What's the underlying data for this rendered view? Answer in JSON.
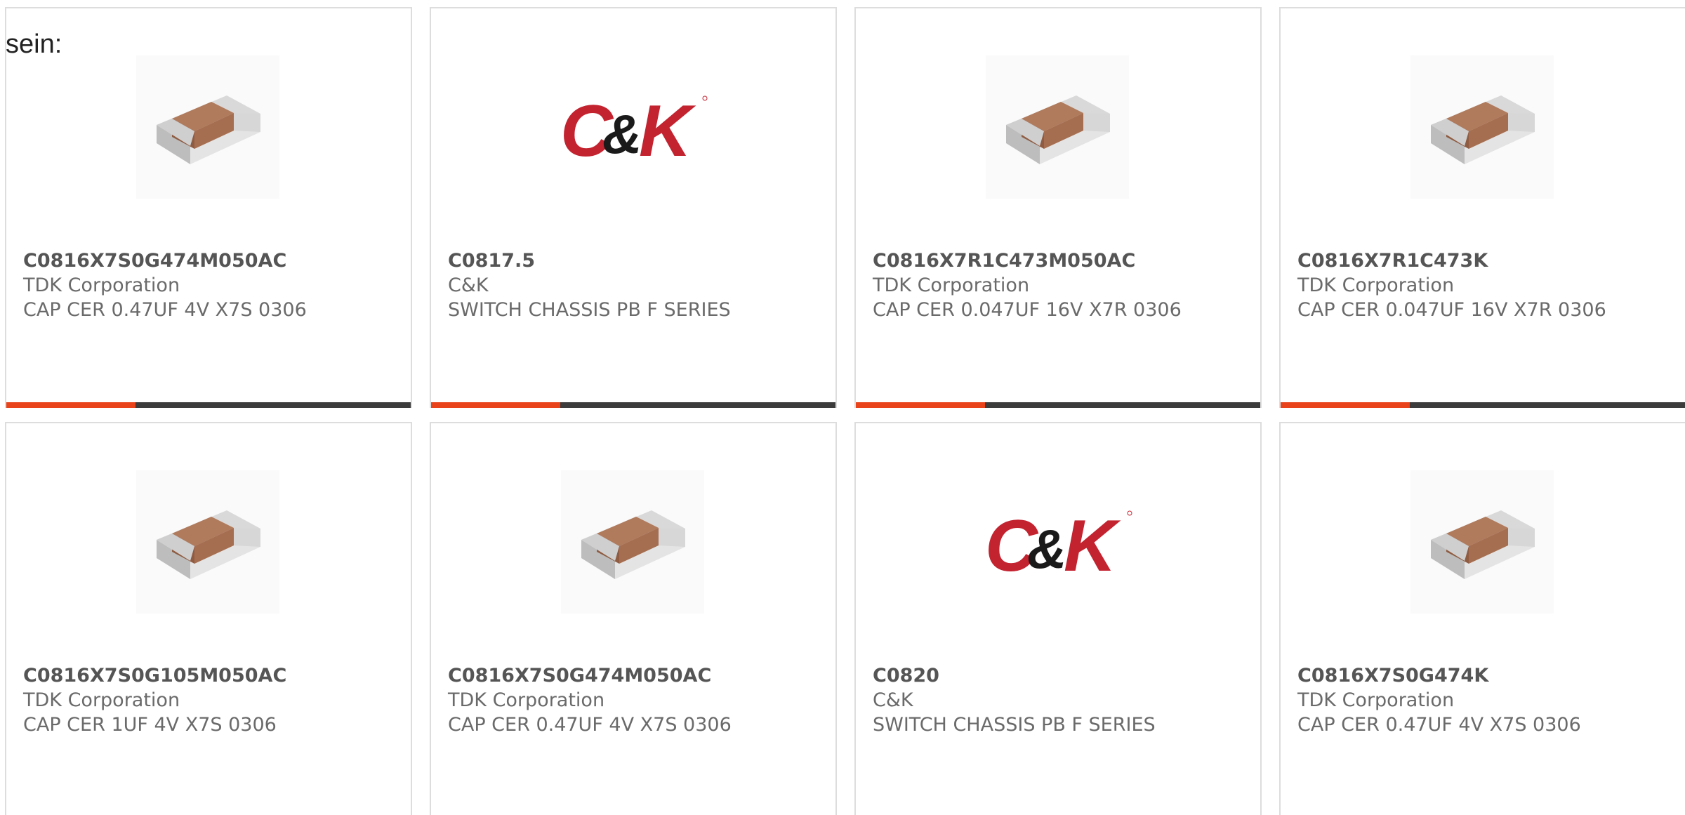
{
  "intro_text": "sein:",
  "colors": {
    "accent": "#e8431b",
    "track": "#3c3c3c",
    "border": "#dddddd",
    "text": "#666666",
    "ck_red": "#c3222f",
    "ck_black": "#1a1a1a"
  },
  "products": [
    {
      "part_number": "C0816X7S0G474M050AC",
      "manufacturer": "TDK Corporation",
      "description": "CAP CER 0.47UF 4V X7S 0306",
      "image": "capacitor-chip",
      "progress": 0.32
    },
    {
      "part_number": "C0817.5",
      "manufacturer": "C&K",
      "description": "SWITCH CHASSIS PB F SERIES",
      "image": "ck-logo",
      "progress": 0.32
    },
    {
      "part_number": "C0816X7R1C473M050AC",
      "manufacturer": "TDK Corporation",
      "description": "CAP CER 0.047UF 16V X7R 0306",
      "image": "capacitor-chip",
      "progress": 0.32
    },
    {
      "part_number": "C0816X7R1C473K",
      "manufacturer": "TDK Corporation",
      "description": "CAP CER 0.047UF 16V X7R 0306",
      "image": "capacitor-chip",
      "progress": 0.32
    },
    {
      "part_number": "C0816X7S0G105M050AC",
      "manufacturer": "TDK Corporation",
      "description": "CAP CER 1UF 4V X7S 0306",
      "image": "capacitor-chip"
    },
    {
      "part_number": "C0816X7S0G474M050AC",
      "manufacturer": "TDK Corporation",
      "description": "CAP CER 0.47UF 4V X7S 0306",
      "image": "capacitor-chip"
    },
    {
      "part_number": "C0820",
      "manufacturer": "C&K",
      "description": "SWITCH CHASSIS PB F SERIES",
      "image": "ck-logo"
    },
    {
      "part_number": "C0816X7S0G474K",
      "manufacturer": "TDK Corporation",
      "description": "CAP CER 0.47UF 4V X7S 0306",
      "image": "capacitor-chip"
    }
  ]
}
